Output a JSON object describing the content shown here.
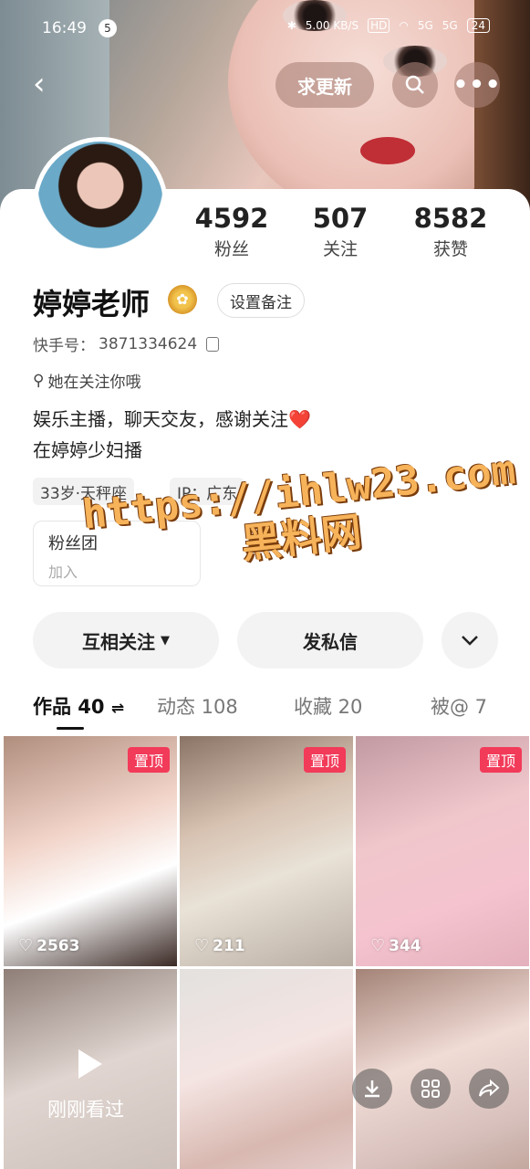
{
  "status_bar": {
    "time": "16:49",
    "notification_count": "5",
    "net_speed": "5.00 KB/S",
    "hd": "HD",
    "signal1": "5G",
    "signal2": "5G",
    "battery": "24"
  },
  "top_nav": {
    "request_update_label": "求更新"
  },
  "profile": {
    "name": "婷婷老师",
    "remark_button": "设置备注",
    "id_label": "快手号：",
    "id_value": "3871334624",
    "follows_you": "她在关注你哦",
    "bio_line1": "娱乐主播，聊天交友，感谢关注❤️",
    "bio_line2": "在婷婷少妇播",
    "tag_age": "33岁·天秤座",
    "tag_ip": "IP：广东"
  },
  "stats": [
    {
      "value": "4592",
      "label": "粉丝"
    },
    {
      "value": "507",
      "label": "关注"
    },
    {
      "value": "8582",
      "label": "获赞"
    }
  ],
  "fan_club": {
    "title": "粉丝团",
    "subtitle": "加入"
  },
  "watermark": {
    "line1": "https://ihlw23.com",
    "line2": "黑料网"
  },
  "actions": {
    "mutual_follow": "互相关注",
    "message": "发私信"
  },
  "tabs": [
    {
      "label": "作品 40"
    },
    {
      "label": "动态 108"
    },
    {
      "label": "收藏 20"
    },
    {
      "label": "被@ 7"
    }
  ],
  "grid": [
    {
      "pinned": "置顶",
      "likes": "2563"
    },
    {
      "pinned": "置顶",
      "likes": "211"
    },
    {
      "pinned": "置顶",
      "likes": "344"
    },
    {
      "overlay": "刚刚看过"
    },
    {},
    {}
  ]
}
